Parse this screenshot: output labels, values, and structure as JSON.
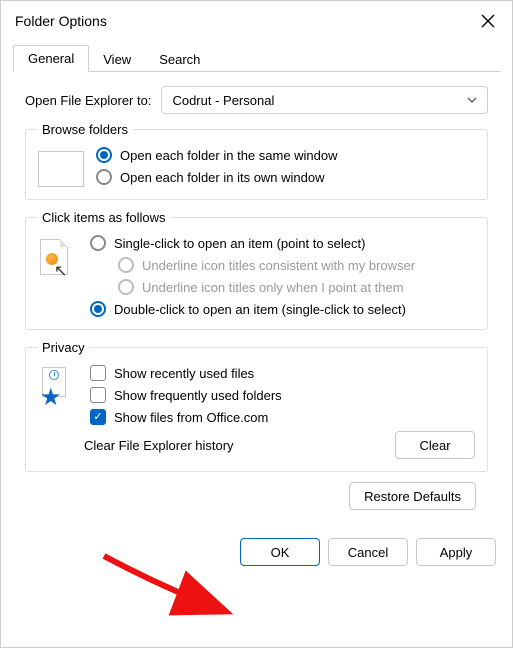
{
  "title": "Folder Options",
  "tabs": {
    "general": "General",
    "view": "View",
    "search": "Search"
  },
  "open_to": {
    "label": "Open File Explorer to:",
    "value": "Codrut - Personal"
  },
  "browse": {
    "legend": "Browse folders",
    "same": "Open each folder in the same window",
    "own": "Open each folder in its own window"
  },
  "click": {
    "legend": "Click items as follows",
    "single": "Single-click to open an item (point to select)",
    "ul_browser": "Underline icon titles consistent with my browser",
    "ul_point": "Underline icon titles only when I point at them",
    "double": "Double-click to open an item (single-click to select)"
  },
  "privacy": {
    "legend": "Privacy",
    "recent": "Show recently used files",
    "freq": "Show frequently used folders",
    "office": "Show files from Office.com",
    "clear_label": "Clear File Explorer history",
    "clear_btn": "Clear"
  },
  "restore": "Restore Defaults",
  "footer": {
    "ok": "OK",
    "cancel": "Cancel",
    "apply": "Apply"
  }
}
